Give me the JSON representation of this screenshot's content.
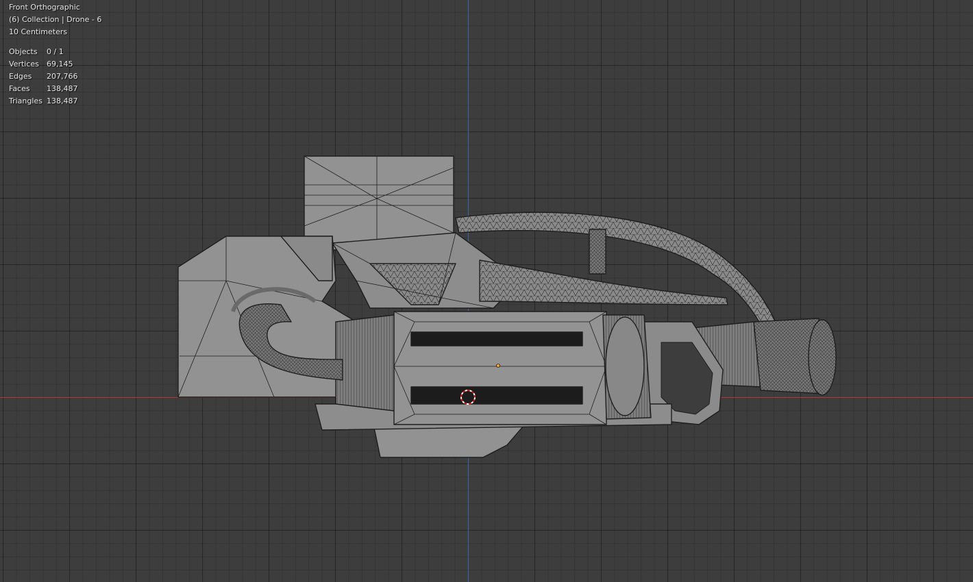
{
  "viewport": {
    "view_name": "Front Orthographic",
    "collection": "(6) Collection | Drone - 6",
    "grid_scale": "10 Centimeters"
  },
  "stats": [
    {
      "label": "Objects",
      "value": "0 / 1"
    },
    {
      "label": "Vertices",
      "value": "69,145"
    },
    {
      "label": "Edges",
      "value": "207,766"
    },
    {
      "label": "Faces",
      "value": "138,487"
    },
    {
      "label": "Triangles",
      "value": "138,487"
    }
  ],
  "colors": {
    "background": "#3d3d3d",
    "x_axis": "#b03a3a",
    "y_axis": "#3c66a8",
    "mesh_face": "#8f8f8f",
    "mesh_edge": "#1e1e1e"
  }
}
